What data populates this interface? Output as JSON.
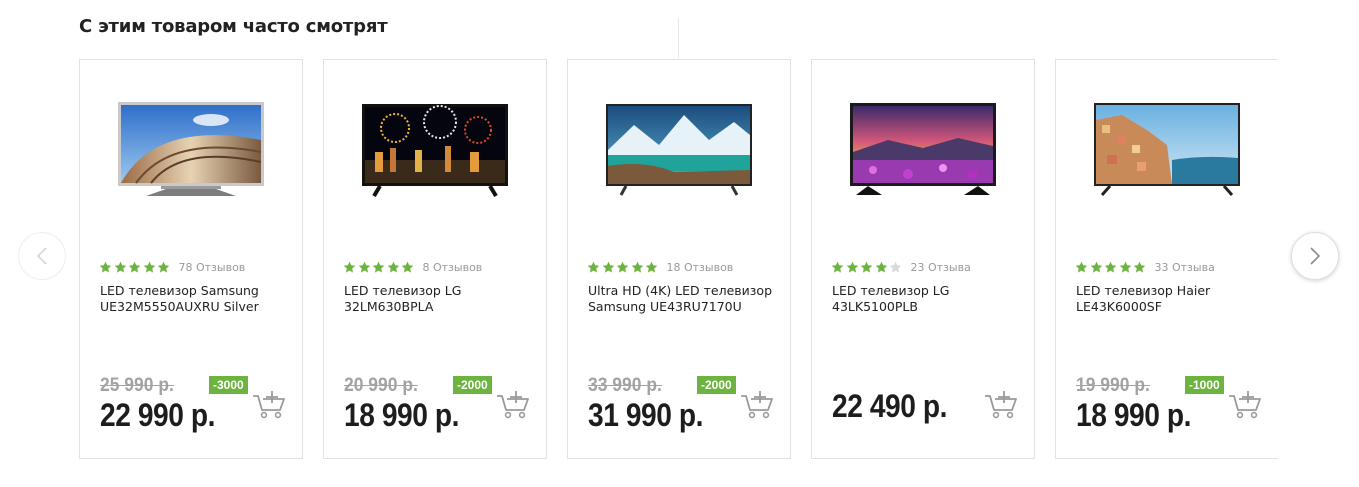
{
  "section": {
    "title": "С этим товаром часто смотрят"
  },
  "colors": {
    "star_filled": "#6cb33f",
    "star_empty": "#d9d9d9",
    "badge": "#6cb33f",
    "old_price": "#a3a3a3"
  },
  "icons": {
    "prev": "chevron-left-icon",
    "next": "chevron-right-icon",
    "cart": "add-to-cart-icon",
    "star": "star-icon"
  },
  "products": [
    {
      "name": "LED телевизор Samsung UE32M5550AUXRU Silver",
      "rating": 5,
      "reviews": "78 Отзывов",
      "old_price": "25 990 р.",
      "discount": "-3000",
      "price": "22 990 р."
    },
    {
      "name": "LED телевизор LG 32LM630BPLA",
      "rating": 5,
      "reviews": "8 Отзывов",
      "old_price": "20 990 р.",
      "discount": "-2000",
      "price": "18 990 р."
    },
    {
      "name": "Ultra HD (4K) LED телевизор Samsung UE43RU7170U",
      "rating": 5,
      "reviews": "18 Отзывов",
      "old_price": "33 990 р.",
      "discount": "-2000",
      "price": "31 990 р."
    },
    {
      "name": "LED телевизор LG 43LK5100PLB",
      "rating": 4,
      "reviews": "23 Отзыва",
      "old_price": "",
      "discount": "",
      "price": "22 490 р."
    },
    {
      "name": "LED телевизор Haier LE43K6000SF",
      "rating": 5,
      "reviews": "33 Отзыва",
      "old_price": "19 990 р.",
      "discount": "-1000",
      "price": "18 990 р."
    }
  ]
}
